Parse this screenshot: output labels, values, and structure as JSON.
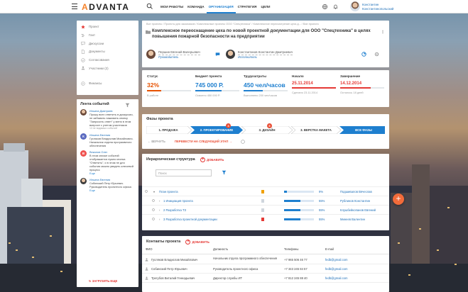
{
  "app": {
    "logo_prefix": "",
    "logo_a": "A",
    "logo_rest": "DVANTA"
  },
  "nav": {
    "items": [
      "Мои работы",
      "Команда",
      "Организация",
      "Стратегия",
      "Цели"
    ],
    "active": 2
  },
  "user": {
    "name_line1": "Константин",
    "name_line2": "Константинопольский"
  },
  "sidebar": {
    "items": [
      {
        "label": "Проект",
        "icon": "star-icon",
        "active": true
      },
      {
        "label": "Гант",
        "icon": "gantt-icon"
      },
      {
        "label": "Дискуссии",
        "icon": "chat-icon"
      },
      {
        "label": "Документы",
        "icon": "document-icon"
      },
      {
        "label": "Согласования",
        "icon": "check-circle-icon"
      },
      {
        "label": "Участники (2)",
        "icon": "users-icon"
      },
      {
        "label": "Финансы",
        "icon": "finance-icon"
      }
    ]
  },
  "feed": {
    "title": "Лента событий",
    "items": [
      {
        "avatar": "photo",
        "who": "Ильина Дмитриев",
        "text": "Прошу всех ответить в дискуссии, не забывать нажимать кнопку \"Запросить ответ\" у меня в этом вопросе с учетом участников",
        "meta": "13 не видимых событий",
        "link": ""
      },
      {
        "avatar": "К",
        "color": "#5c6bc0",
        "who": "Ильина Евгения",
        "text": "Гусляков Владислав Михайлович. Начальник отдела программного обеспечения",
        "meta": "",
        "link": ""
      },
      {
        "avatar": "В",
        "color": "#ef5350",
        "who": "Векалов Олег",
        "text": "В этом списке событий отображается нужно кнопка \"Ответить\", и в этом не для события можно увидеть ключевой процесс",
        "meta": "",
        "link": "Еще"
      },
      {
        "avatar": "photo",
        "who": "Ильина Евгения",
        "text": "Собинский Петр Юрьевич. Руководитель проектного офиса",
        "meta": "",
        "link": "Еще"
      }
    ],
    "load_more": "ЗАГРУЗИТЬ ЕЩЕ"
  },
  "header": {
    "breadcrumb": "Все проекты / Проекты для заказчиков / Комплексные проекты ООО \"Спецтехника\" / Комплексное пересмотрение цеха д... / Ван проекта",
    "title": "Комплексное переоснащение цеха по новой проектной документации для ООО \"Спецтехника\" в целях повышения пожарной безопасности на предприятии",
    "people": [
      {
        "name": "Першин Евгений Валерьевич",
        "role": "Руководитель"
      },
      {
        "name": "Константинов Константин Дмитриевич",
        "role": "Исполнитель"
      }
    ]
  },
  "stats": [
    {
      "label": "Статус",
      "value": "32%",
      "sub": "В работе",
      "color": "#e65100",
      "progress": 32
    },
    {
      "label": "Бюджет проекта",
      "value": "745 000 Р.",
      "sub": "Освоено 450 000 Р.",
      "color": "#1e7fcf",
      "progress": 60
    },
    {
      "label": "Трудозатраты",
      "value": "450 чел/часов",
      "sub": "Выполнено 200 чел/часов",
      "color": "#1e7fcf",
      "progress": 44
    },
    {
      "label": "Начало",
      "value": "25.11.2014",
      "sub": "Сделано 23.11.2014",
      "color": "#e53935",
      "progress": 100
    },
    {
      "label": "Завершение",
      "value": "14.12.2014",
      "sub": "Осталось 18 дней",
      "color": "#e53935",
      "progress": 70
    }
  ],
  "phase": {
    "title": "Фазы проекта",
    "steps": [
      {
        "label": "1. ПРОДАЖА",
        "state": "done"
      },
      {
        "label": "2. ПРОЕКТИРОВАНИЕ",
        "state": "current",
        "badge": "3"
      },
      {
        "label": "3. ДИЗАЙН",
        "state": "todo",
        "badge": "5"
      },
      {
        "label": "3. ВЕРСТКА МАКЕТА",
        "state": "todo"
      },
      {
        "label": "ВСЕ ФАЗЫ",
        "state": "link"
      }
    ],
    "back": "ВЕРНУТЬ",
    "next": "ПЕРЕВЕСТИ НА СЛЕДУЮЩИЙ ЭТАП"
  },
  "hierarchy": {
    "title": "Иерархическая структура",
    "add": "ДОБАВИТЬ",
    "search_placeholder": "Поиск",
    "rows": [
      {
        "name": "План проекта",
        "level": 0,
        "progress": 9,
        "pct": "9%",
        "owner": "Подшивалов Вячеслав",
        "flag": "#f0a000"
      },
      {
        "name": "1 Инициация проекта",
        "level": 1,
        "progress": 55,
        "pct": "55%",
        "owner": "Рублинов Константин",
        "flag": "#cfd6dd"
      },
      {
        "name": "2 Разработка ТЗ",
        "level": 1,
        "progress": 55,
        "pct": "55%",
        "owner": "Клушбейкопанов Евгений",
        "flag": "#cfd6dd"
      },
      {
        "name": "3 Разработка проектной документации",
        "level": 1,
        "progress": 55,
        "pct": "55%",
        "owner": "Минеев Валентин",
        "flag": "#e53935"
      }
    ]
  },
  "contacts": {
    "title": "Контакты проекта",
    "add": "ДОБАВИТЬ",
    "headers": [
      "ФИО",
      "Должность",
      "Телефоны",
      "E-mail"
    ],
    "rows": [
      {
        "name": "Гусляков Владислав Михайлович",
        "pos": "Начальник отдела программного обеспечения",
        "phone": "+7 965 506 46 77",
        "email": "fedb@gmail.com"
      },
      {
        "name": "Собинский Петр Юрьевич",
        "pos": "Руководитель проектного офиса",
        "phone": "+7 343 245 84 57",
        "email": "fedb@gmail.com"
      },
      {
        "name": "Трегубов Виталий Геннадьевич",
        "pos": "Директор службы ИТ",
        "phone": "+7 812 245 88 40",
        "email": "fedb@gmail.com"
      }
    ]
  },
  "colors": {
    "accent": "#1e7fcf",
    "orange": "#f26b3a",
    "red": "#e53935"
  }
}
